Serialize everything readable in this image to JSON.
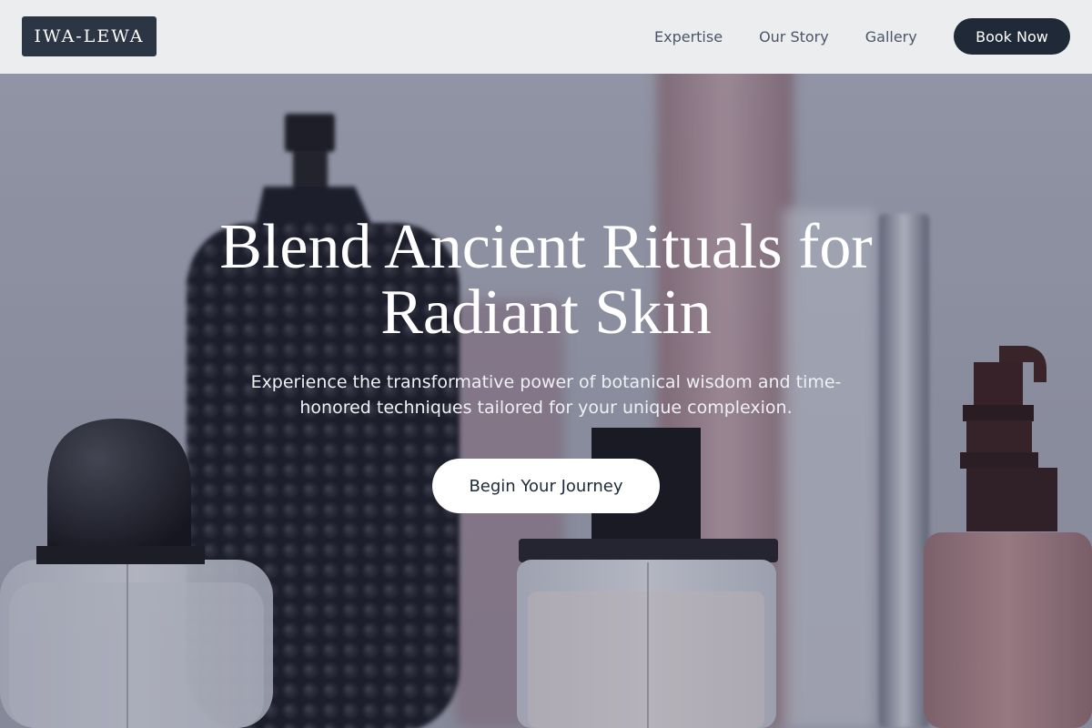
{
  "brand": {
    "name": "IWA-LEWA"
  },
  "nav": {
    "links": [
      {
        "label": "Expertise"
      },
      {
        "label": "Our Story"
      },
      {
        "label": "Gallery"
      }
    ],
    "book_label": "Book Now"
  },
  "hero": {
    "headline": "Blend Ancient Rituals for Radiant Skin",
    "subtext": "Experience the transformative power of botanical wisdom and time-honored techniques tailored for your unique complexion.",
    "cta_label": "Begin Your Journey"
  },
  "colors": {
    "header_bg": "#ecedef",
    "logo_bg": "#2c3544",
    "primary_button": "#1f2937",
    "nav_text": "#4a5568"
  }
}
